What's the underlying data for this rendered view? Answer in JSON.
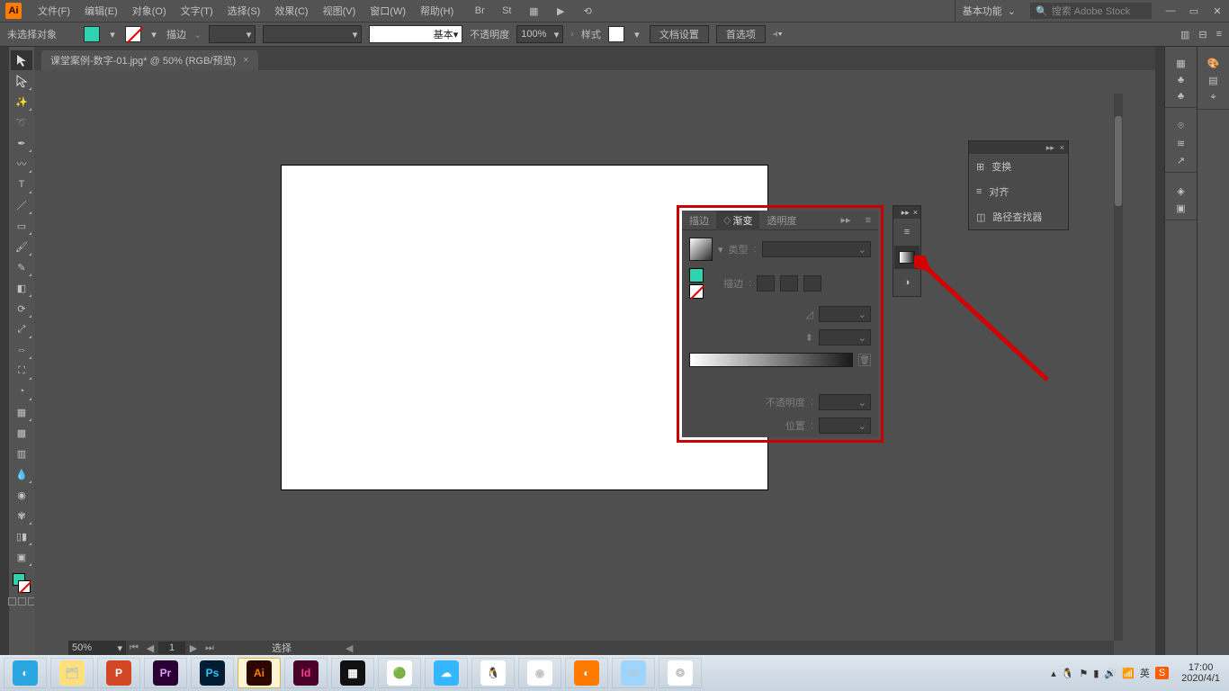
{
  "titlebar": {
    "logo": "Ai",
    "menus": [
      "文件(F)",
      "编辑(E)",
      "对象(O)",
      "文字(T)",
      "选择(S)",
      "效果(C)",
      "视图(V)",
      "窗口(W)",
      "帮助(H)"
    ],
    "workspace_label": "基本功能",
    "search_placeholder": "搜索 Adobe Stock"
  },
  "controlbar": {
    "status": "未选择对象",
    "stroke_label": "描边",
    "stroke_val": "",
    "brush_label": "基本",
    "opacity_label": "不透明度",
    "opacity_val": "100%",
    "style_label": "样式",
    "docsetup": "文档设置",
    "prefs": "首选项"
  },
  "doc": {
    "tab": "课堂案例-数字-01.jpg* @ 50% (RGB/预览)"
  },
  "bottom": {
    "zoom": "50%",
    "page": "1",
    "select_label": "选择"
  },
  "transform_panel": {
    "items": [
      "变换",
      "对齐",
      "路径查找器"
    ]
  },
  "gradient_panel": {
    "tabs": [
      "描边",
      "渐变",
      "透明度"
    ],
    "type_label": "类型",
    "stroke_label": "描边",
    "opacity_label": "不透明度",
    "position_label": "位置"
  },
  "taskbar": {
    "time": "17:00",
    "date": "2020/4/1",
    "ime": "英",
    "apps": [
      "QQ",
      "Ex",
      "P3",
      "Pr",
      "Ps",
      "Ai",
      "Id",
      "Me",
      "Op",
      "Br",
      "QQ",
      "Ch",
      "Ff",
      "Bk",
      "Sb"
    ]
  }
}
